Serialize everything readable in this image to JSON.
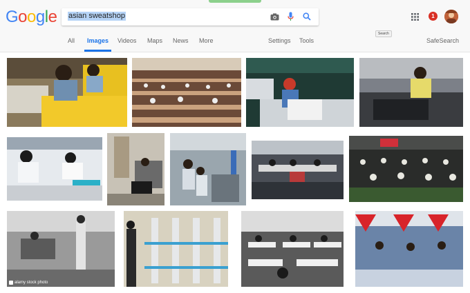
{
  "search": {
    "query": "asian sweatshop"
  },
  "logo": {
    "letters": [
      "G",
      "o",
      "o",
      "g",
      "l",
      "e"
    ]
  },
  "tabs": {
    "all": "All",
    "images": "Images",
    "videos": "Videos",
    "maps": "Maps",
    "news": "News",
    "more": "More",
    "settings": "Settings",
    "tools": "Tools",
    "safesearch": "SafeSearch"
  },
  "tooltip": {
    "search": "Search"
  },
  "header": {
    "notification_count": "1"
  },
  "watermark": {
    "text": "alamy stock photo"
  },
  "icons": [
    "camera-icon",
    "microphone-icon",
    "search-icon",
    "apps-grid-icon",
    "notification-badge",
    "avatar"
  ],
  "colors": {
    "accent": "#1a73e8",
    "g_blue": "#4285F4",
    "g_red": "#EA4335",
    "g_yellow": "#FBBC05",
    "g_green": "#34A853"
  }
}
